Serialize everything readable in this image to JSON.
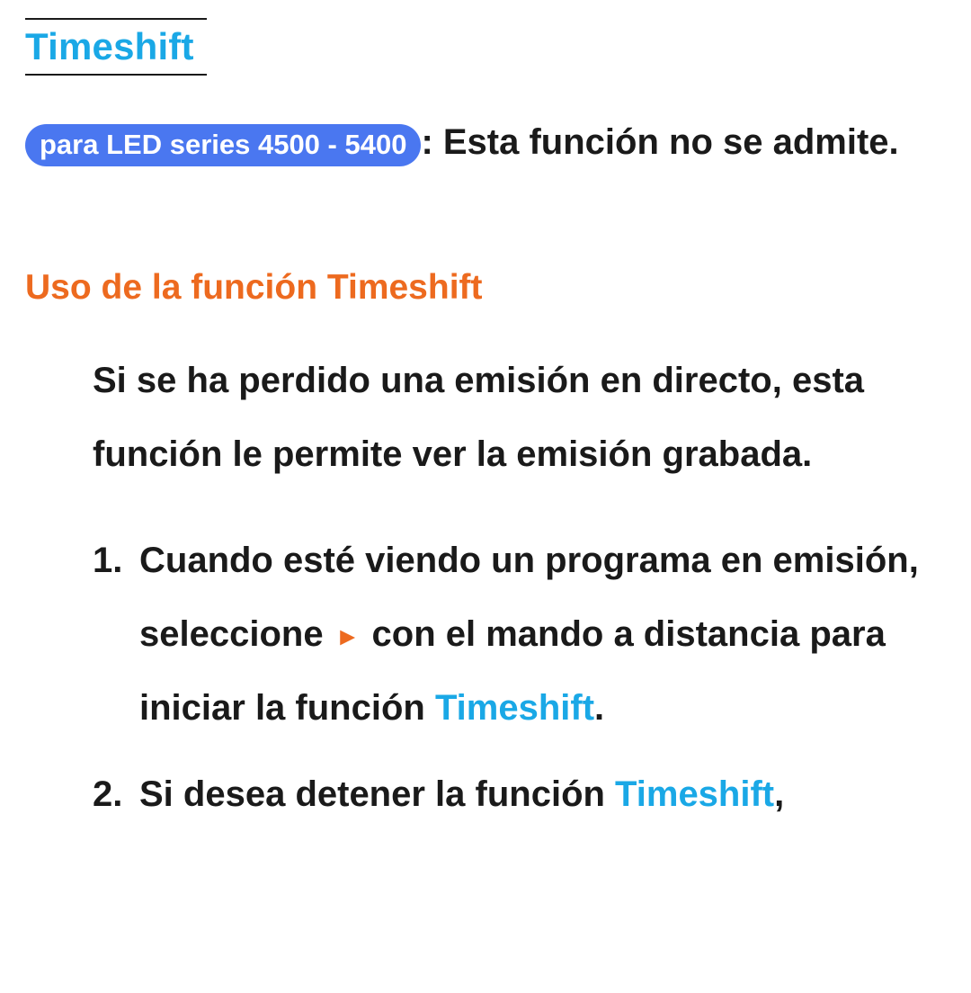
{
  "title": "Timeshift",
  "pill": "para LED series 4500 - 5400",
  "note_after_pill": ": Esta función no se admite.",
  "subhead": "Uso de la función Timeshift",
  "intro": "Si se ha perdido una emisión en directo, esta función le permite ver la emisión grabada.",
  "steps": [
    {
      "part1": "Cuando esté viendo un programa en emisión, seleccione ",
      "play_icon": "►",
      "part2": " con el mando a distancia para iniciar la función ",
      "highlight": "Timeshift",
      "part3": "."
    },
    {
      "part1": "Si desea detener la función ",
      "highlight": "Timeshift",
      "part3": ","
    }
  ]
}
